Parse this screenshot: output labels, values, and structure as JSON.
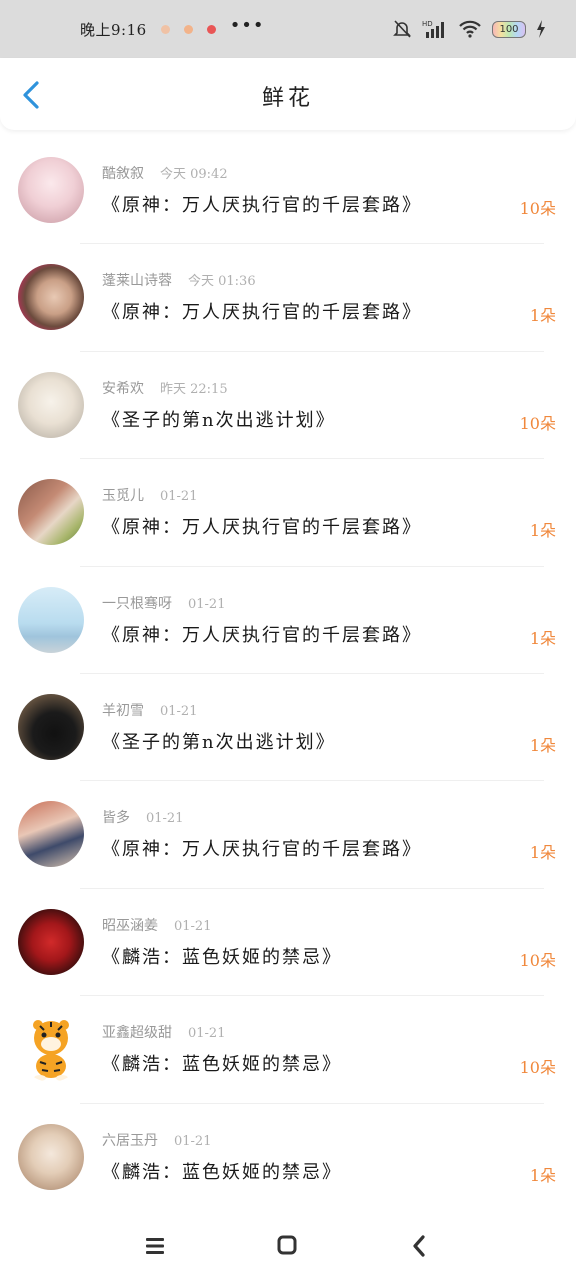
{
  "status_bar": {
    "time": "晚上9:16",
    "more": "•••",
    "battery": "100",
    "icons": [
      "silent-bell-icon",
      "hd-signal-icon",
      "wifi-icon",
      "battery-icon",
      "charging-icon"
    ]
  },
  "header": {
    "title": "鲜花",
    "back_icon": "chevron-left-icon"
  },
  "accent_color": "#f0883c",
  "back_color": "#2f93dc",
  "items": [
    {
      "user": "酷敘叙",
      "time": "今天 09:42",
      "book": "《原神：万人厌执行官的千层套路》",
      "amount": "10朵"
    },
    {
      "user": "蓬莱山诗蓉",
      "time": "今天 01:36",
      "book": "《原神：万人厌执行官的千层套路》",
      "amount": "1朵"
    },
    {
      "user": "安希欢",
      "time": "昨天 22:15",
      "book": "《圣子的第n次出逃计划》",
      "amount": "10朵"
    },
    {
      "user": "玉觅儿",
      "time": "01-21",
      "book": "《原神：万人厌执行官的千层套路》",
      "amount": "1朵"
    },
    {
      "user": "一只根骞呀",
      "time": "01-21",
      "book": "《原神：万人厌执行官的千层套路》",
      "amount": "1朵"
    },
    {
      "user": "羊初雪",
      "time": "01-21",
      "book": "《圣子的第n次出逃计划》",
      "amount": "1朵"
    },
    {
      "user": "皆多",
      "time": "01-21",
      "book": "《原神：万人厌执行官的千层套路》",
      "amount": "1朵"
    },
    {
      "user": "昭巫涵姜",
      "time": "01-21",
      "book": "《麟浩：蓝色妖姬的禁忌》",
      "amount": "10朵"
    },
    {
      "user": "亚鑫超级甜",
      "time": "01-21",
      "book": "《麟浩：蓝色妖姬的禁忌》",
      "amount": "10朵"
    },
    {
      "user": "六居玉丹",
      "time": "01-21",
      "book": "《麟浩：蓝色妖姬的禁忌》",
      "amount": "1朵"
    }
  ],
  "nav_bar": {
    "icons": [
      "menu-icon",
      "home-square-icon",
      "back-triangle-icon"
    ]
  }
}
